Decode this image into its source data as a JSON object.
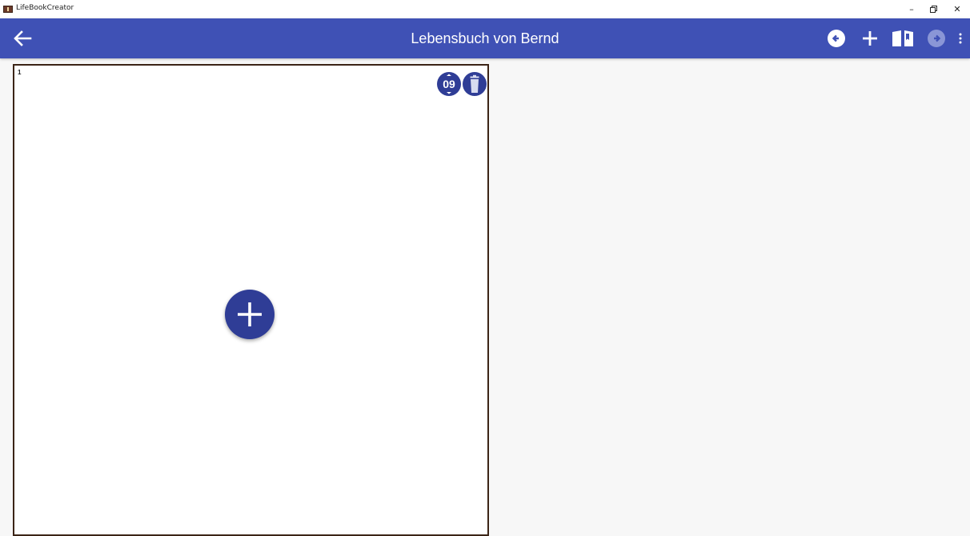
{
  "window": {
    "title": "LifeBookCreator",
    "minimize_glyph": "–",
    "maximize_glyph": "▫",
    "close_glyph": "✕"
  },
  "appbar": {
    "title": "Lebensbuch von Bernd",
    "icons": [
      "back-arrow-icon",
      "previous-page-icon",
      "add-icon",
      "book-icon",
      "next-page-icon",
      "more-vert-icon"
    ],
    "color": "#3f51b5"
  },
  "page": {
    "number": "1",
    "order_badge": "09",
    "icons": [
      "reorder-icon",
      "delete-icon",
      "add-content-icon"
    ],
    "border_color": "#3b2416",
    "accent": "#2f3d96"
  }
}
